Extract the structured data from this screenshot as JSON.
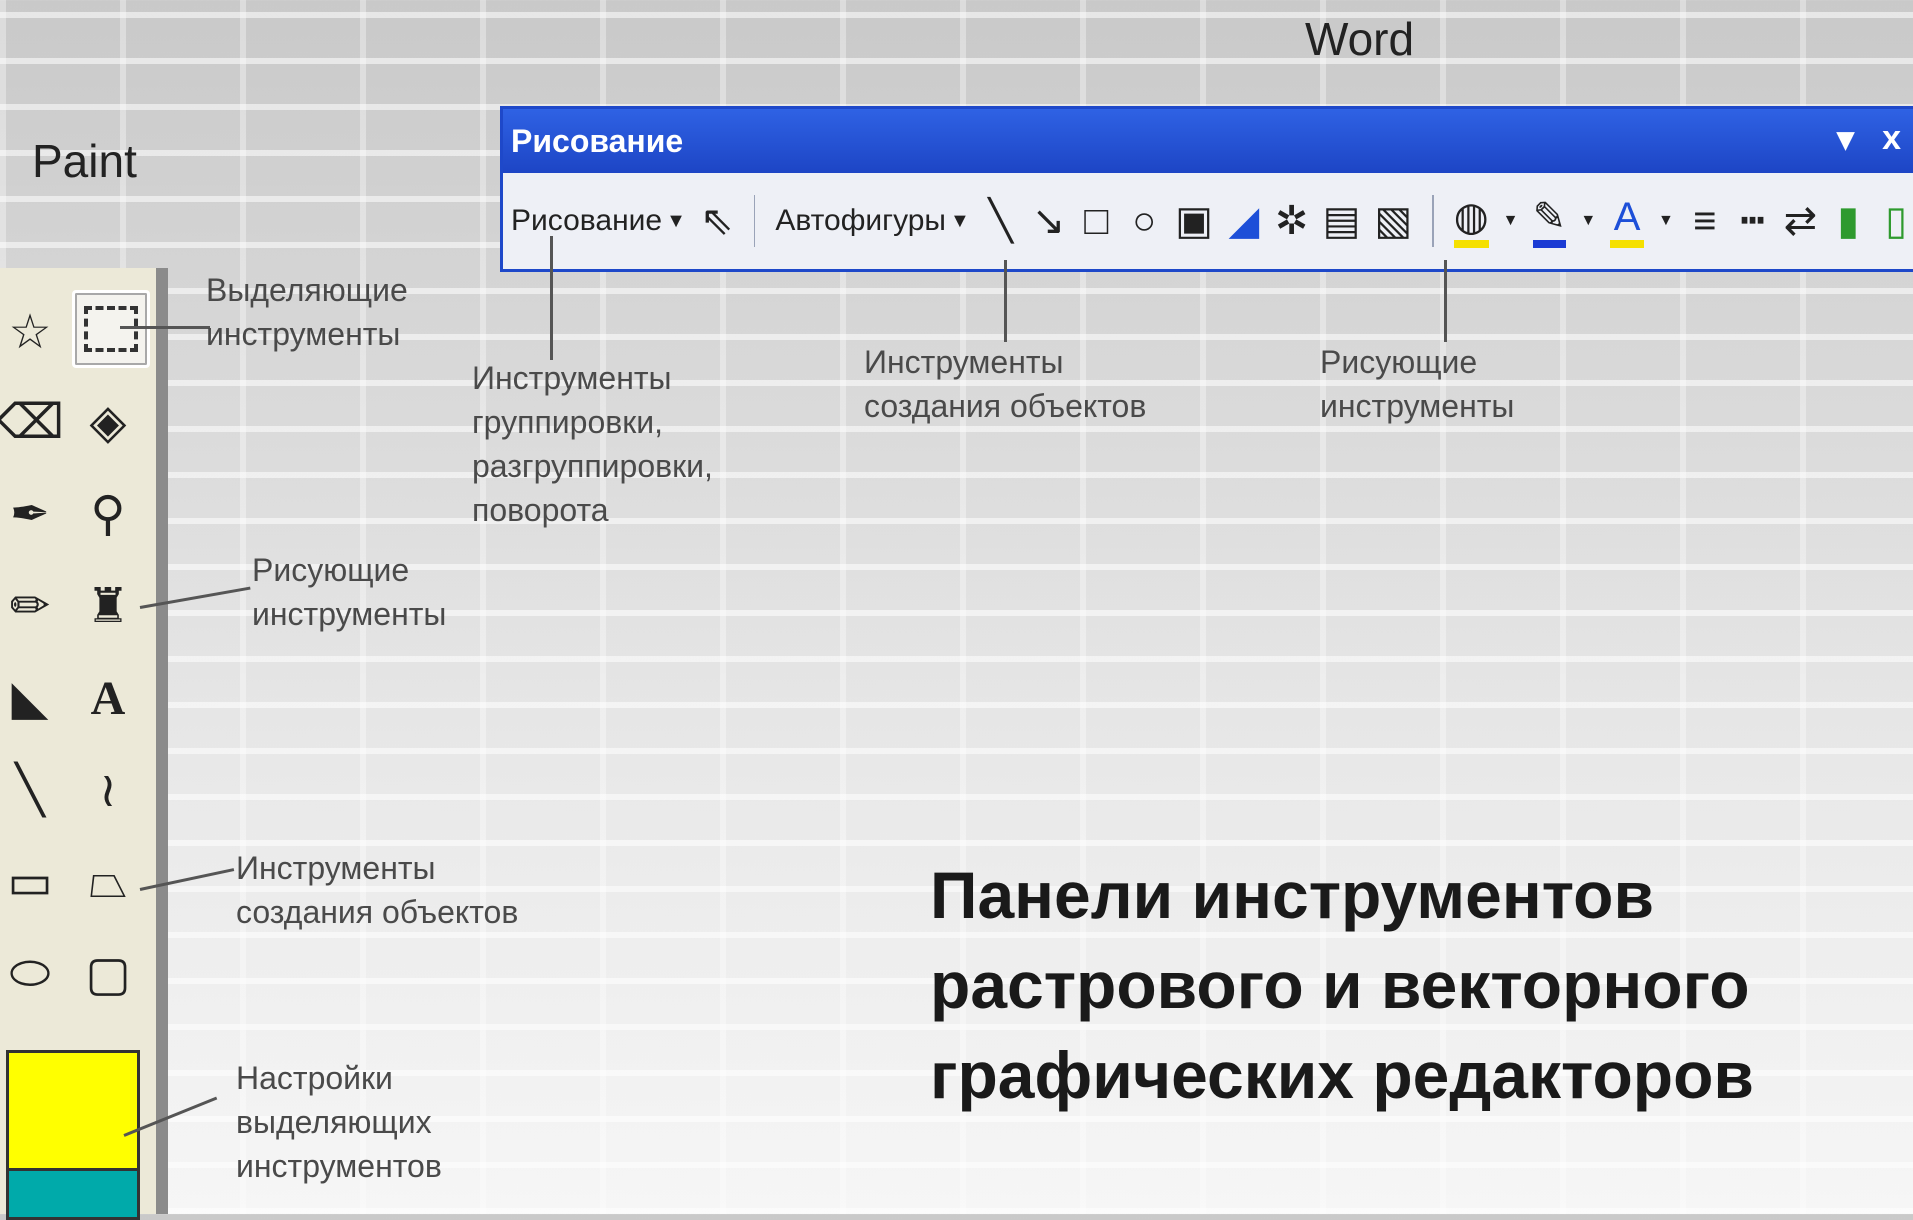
{
  "labels": {
    "word": "Word",
    "paint": "Paint"
  },
  "word_toolbar": {
    "title": "Рисование",
    "menu_label": "Рисование",
    "autoshapes_label": "Автофигуры",
    "title_dropdown": "▾",
    "title_close": "x"
  },
  "annotations": {
    "word_group": [
      "Инструменты",
      "группировки,",
      "разгруппировки,",
      "поворота"
    ],
    "word_create": [
      "Инструменты",
      "создания объектов"
    ],
    "word_draw": [
      "Рисующие",
      "инструменты"
    ],
    "paint_select": [
      "Выделяющие",
      "инструменты"
    ],
    "paint_draw": [
      "Рисующие",
      "инструменты"
    ],
    "paint_create": [
      "Инструменты",
      "создания объектов"
    ],
    "paint_settings": [
      "Настройки",
      "выделяющих",
      "инструментов"
    ]
  },
  "heading": [
    "Панели инструментов",
    "растрового  и векторного",
    "графических редакторов"
  ],
  "colors": {
    "titlebar": "#1d45c5",
    "fill_yellow": "#f5e000",
    "line_blue": "#1b3bd4"
  }
}
